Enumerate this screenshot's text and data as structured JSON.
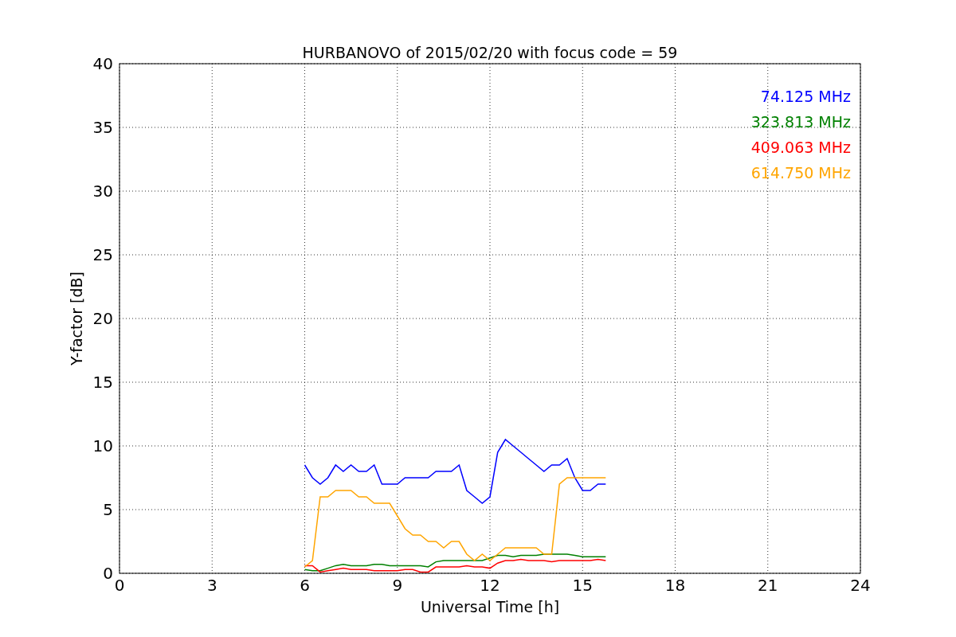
{
  "chart_data": {
    "type": "line",
    "title": "HURBANOVO of 2015/02/20 with focus code = 59",
    "xlabel": "Universal Time [h]",
    "ylabel": "Y-factor [dB]",
    "xlim": [
      0,
      24
    ],
    "ylim": [
      0,
      40
    ],
    "xticks": [
      0,
      3,
      6,
      9,
      12,
      15,
      18,
      21,
      24
    ],
    "yticks": [
      0,
      5,
      10,
      15,
      20,
      25,
      30,
      35,
      40
    ],
    "grid": true,
    "x": [
      6.0,
      6.25,
      6.5,
      6.75,
      7.0,
      7.25,
      7.5,
      7.75,
      8.0,
      8.25,
      8.5,
      8.75,
      9.0,
      9.25,
      9.5,
      9.75,
      10.0,
      10.25,
      10.5,
      10.75,
      11.0,
      11.25,
      11.5,
      11.75,
      12.0,
      12.25,
      12.5,
      12.75,
      13.0,
      13.25,
      13.5,
      13.75,
      14.0,
      14.25,
      14.5,
      14.75,
      15.0,
      15.25,
      15.5,
      15.75
    ],
    "series": [
      {
        "name": "74.125 MHz",
        "color": "#0000ff",
        "values": [
          8.5,
          7.5,
          7,
          7.5,
          8.5,
          8,
          8.5,
          8,
          8,
          8.5,
          7,
          7,
          7,
          7.5,
          7.5,
          7.5,
          7.5,
          8,
          8,
          8,
          8.5,
          6.5,
          6,
          5.5,
          6,
          9.5,
          10.5,
          10,
          9.5,
          9,
          8.5,
          8,
          8.5,
          8.5,
          9,
          7.5,
          6.5,
          6.5,
          7,
          7
        ]
      },
      {
        "name": "323.813 MHz",
        "color": "#008000",
        "values": [
          0.3,
          0.2,
          0.2,
          0.4,
          0.6,
          0.7,
          0.6,
          0.6,
          0.6,
          0.7,
          0.7,
          0.6,
          0.6,
          0.6,
          0.6,
          0.6,
          0.5,
          0.9,
          1,
          1,
          1,
          1,
          1,
          1,
          1.2,
          1.4,
          1.4,
          1.3,
          1.4,
          1.4,
          1.4,
          1.5,
          1.5,
          1.5,
          1.5,
          1.4,
          1.3,
          1.3,
          1.3,
          1.3
        ]
      },
      {
        "name": "409.063 MHz",
        "color": "#ff0000",
        "values": [
          0.6,
          0.6,
          0.1,
          0.2,
          0.3,
          0.4,
          0.3,
          0.3,
          0.3,
          0.2,
          0.2,
          0.2,
          0.2,
          0.3,
          0.3,
          0.1,
          0.1,
          0.5,
          0.5,
          0.5,
          0.5,
          0.6,
          0.5,
          0.5,
          0.4,
          0.8,
          1,
          1,
          1.1,
          1,
          1,
          1,
          0.9,
          1,
          1,
          1,
          1,
          1,
          1.1,
          1
        ]
      },
      {
        "name": "614.750 MHz",
        "color": "#ffa500",
        "values": [
          0.5,
          1,
          6,
          6,
          6.5,
          6.5,
          6.5,
          6,
          6,
          5.5,
          5.5,
          5.5,
          4.5,
          3.5,
          3,
          3,
          2.5,
          2.5,
          2,
          2.5,
          2.5,
          1.5,
          1,
          1.5,
          1,
          1.5,
          2,
          2,
          2,
          2,
          2,
          1.5,
          1.5,
          7,
          7.5,
          7.5,
          7.5,
          7.5,
          7.5,
          7.5
        ]
      }
    ]
  }
}
